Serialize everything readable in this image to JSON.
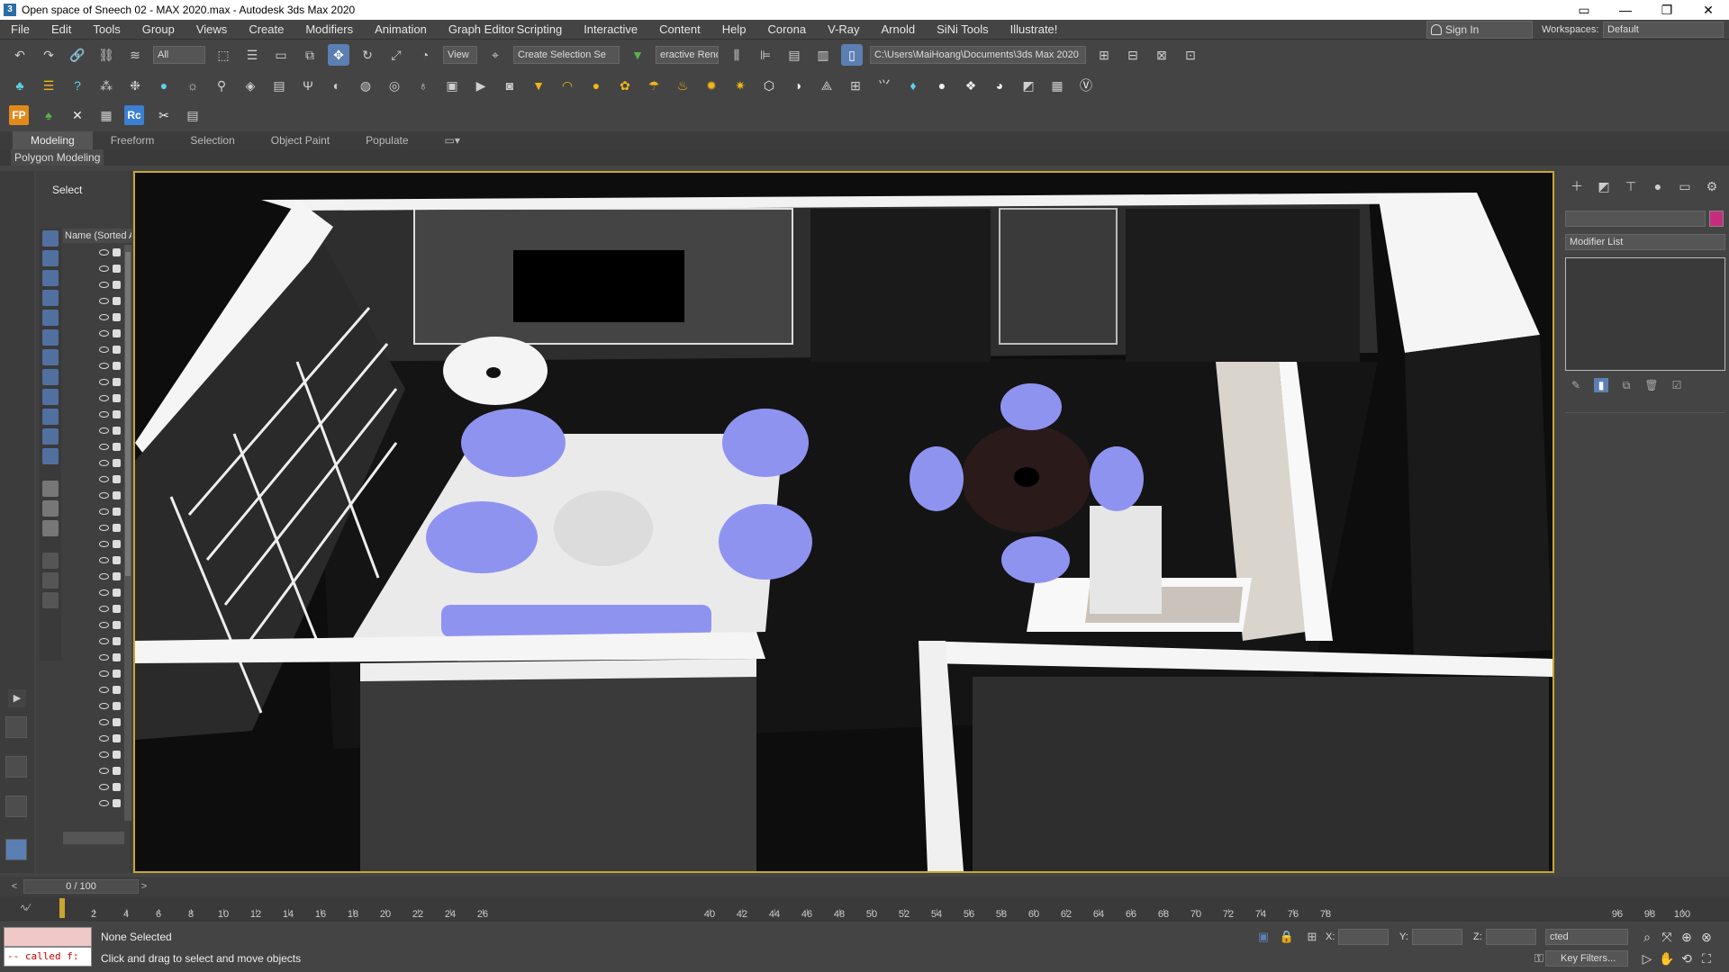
{
  "window": {
    "title": "Open space of Sneech 02 - MAX 2020.max - Autodesk 3ds Max 2020",
    "app_icon": "3",
    "controls": [
      "—",
      "❐",
      "✕"
    ]
  },
  "menubar": {
    "items": [
      "File",
      "Edit",
      "Tools",
      "Group",
      "Views",
      "Create",
      "Modifiers",
      "Animation",
      "Graph Editor",
      "Scripting",
      "Interactive",
      "Content",
      "Help",
      "Corona",
      "V-Ray",
      "Arnold",
      "SiNi Tools",
      "Illustrate!"
    ],
    "sign_in": "Sign In",
    "workspaces_label": "Workspaces:",
    "workspaces_value": "Default"
  },
  "toolbar1": {
    "filter": "All",
    "view": "View",
    "selection_set": "Create Selection Se",
    "interactive_render": "eractive Rende",
    "path": "C:\\Users\\MaiHoang\\Documents\\3ds Max 2020"
  },
  "toolbar3": {
    "fp_label": "FP",
    "rc_label": "Rc"
  },
  "ribbon": {
    "tabs": [
      "Modeling",
      "Freeform",
      "Selection",
      "Object Paint",
      "Populate"
    ],
    "active": "Modeling",
    "sub_label": "Polygon Modeling"
  },
  "explorer": {
    "select_label": "Select",
    "column_header": "Name (Sorted A"
  },
  "command_panel": {
    "modifier_list": "Modifier List",
    "object_color": "#c42d7e"
  },
  "timeline": {
    "frame_label": "0 / 100",
    "current_frame": 0,
    "ticks": [
      2,
      4,
      6,
      8,
      10,
      12,
      14,
      16,
      18,
      20,
      22,
      24,
      26,
      40,
      42,
      44,
      46,
      48,
      50,
      52,
      54,
      56,
      58,
      60,
      62,
      64,
      66,
      68,
      70,
      72,
      74,
      76,
      78,
      96,
      98,
      100
    ]
  },
  "status": {
    "maxscript_output": "-- called f:",
    "selection": "None Selected",
    "prompt": "Click and drag to select and move objects",
    "x_label": "X:",
    "y_label": "Y:",
    "z_label": "Z:",
    "key_mode": "cted",
    "key_filters": "Key Filters..."
  },
  "colors": {
    "accent": "#5b7fb3",
    "viewport_border": "#c9a531",
    "sofa_blue": "#8f93f0"
  }
}
